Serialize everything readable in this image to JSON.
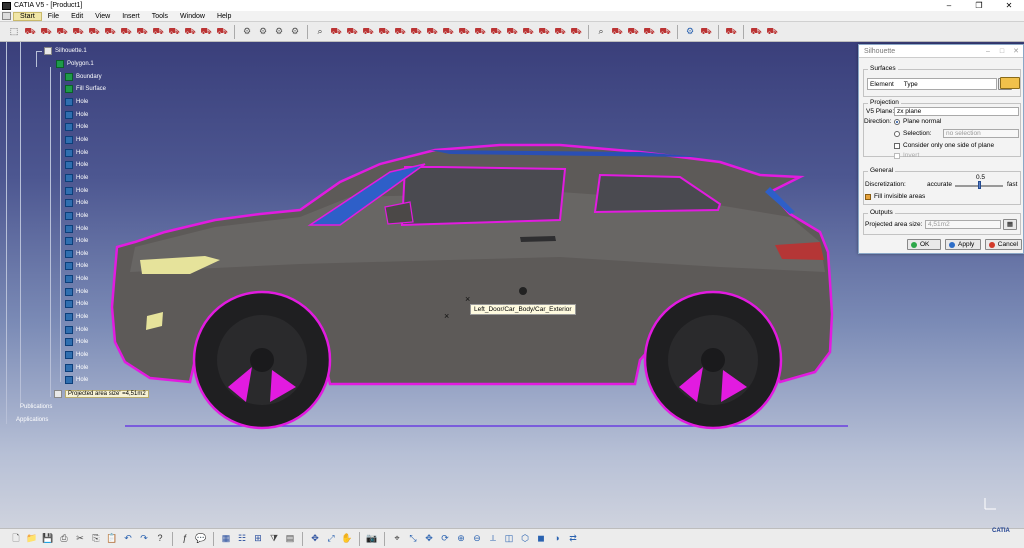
{
  "window": {
    "title": "CATIA V5 - [Product1]",
    "minimize": "–",
    "restore": "❐",
    "close": "✕"
  },
  "menu": [
    "Start",
    "File",
    "Edit",
    "View",
    "Insert",
    "Tools",
    "Window",
    "Help"
  ],
  "tree": {
    "root": "Silhouette.1",
    "polygon": "Polygon.1",
    "boundary": "Boundary",
    "fill_surface": "Fill Surface",
    "holes": [
      "Hole",
      "Hole",
      "Hole",
      "Hole",
      "Hole",
      "Hole",
      "Hole",
      "Hole",
      "Hole",
      "Hole",
      "Hole",
      "Hole",
      "Hole",
      "Hole",
      "Hole",
      "Hole",
      "Hole",
      "Hole",
      "Hole",
      "Hole",
      "Hole",
      "Hole",
      "Hole"
    ],
    "projected_area": "Projected area size' =4,51m2",
    "publications": "Publications",
    "applications": "Applications"
  },
  "tooltip": "Left_Door/Car_Body/Car_Exterior",
  "dialog": {
    "title": "Silhouette",
    "surfaces_group": "Surfaces",
    "element_label": "Element",
    "element_col": "Type",
    "projection_group": "Projection",
    "v5plane_label": "V5 Plane:",
    "v5plane_value": "zx plane",
    "direction_label": "Direction:",
    "plane_normal": "Plane normal",
    "selection_label": "Selection:",
    "selection_value": "no selection",
    "one_side": "Consider only one side of plane",
    "invert": "Invert",
    "general_group": "General",
    "discretization_label": "Discretization:",
    "accurate": "accurate",
    "discretization_value": "0.5",
    "fast": "fast",
    "fill_invisible": "Fill invisible areas",
    "outputs_group": "Outputs",
    "projected_area_label": "Projected area size:",
    "projected_area_value": "4,51m2",
    "ok": "OK",
    "apply": "Apply",
    "cancel": "Cancel"
  },
  "brand": "CATIA"
}
